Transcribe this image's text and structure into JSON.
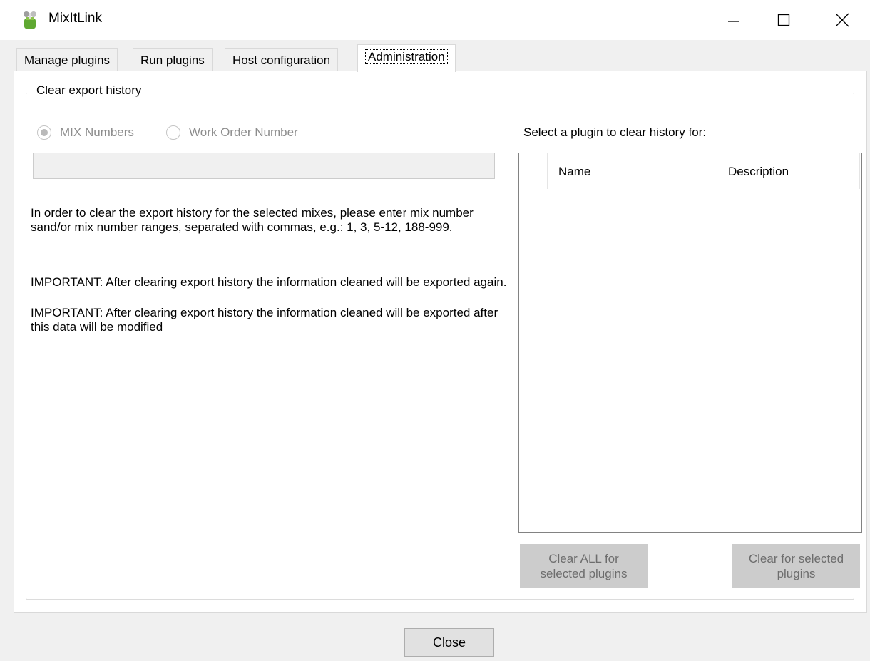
{
  "window": {
    "title": "MixItLink",
    "icon": "app-icon"
  },
  "tabs": [
    {
      "label": "Manage plugins"
    },
    {
      "label": "Run plugins"
    },
    {
      "label": "Host configuration"
    },
    {
      "label": "Administration",
      "active": true
    }
  ],
  "group": {
    "legend": "Clear export history",
    "radio_mix": "MIX Numbers",
    "radio_work_order": "Work Order Number",
    "selected_radio": "MIX Numbers",
    "input_value": "",
    "info_1": "In order to clear the export history for the selected mixes, please enter mix number sand/or mix number ranges, separated with commas, e.g.: 1, 3, 5-12, 188-999.",
    "info_2": "IMPORTANT: After clearing export history the information cleaned will be exported again.",
    "info_3": "IMPORTANT: After clearing export history the information  cleaned will be exported after this data will be modified",
    "plugin_label": "Select a plugin to clear history for:",
    "columns": {
      "name": "Name",
      "description": "Description"
    },
    "btn_clear_all": "Clear ALL for selected plugins",
    "btn_clear_selected": "Clear for selected plugins"
  },
  "footer": {
    "close_label": "Close"
  },
  "colors": {
    "window_bg": "#f0f0f0",
    "disabled_button": "#cccccc",
    "disabled_text": "#8d8d8d"
  }
}
